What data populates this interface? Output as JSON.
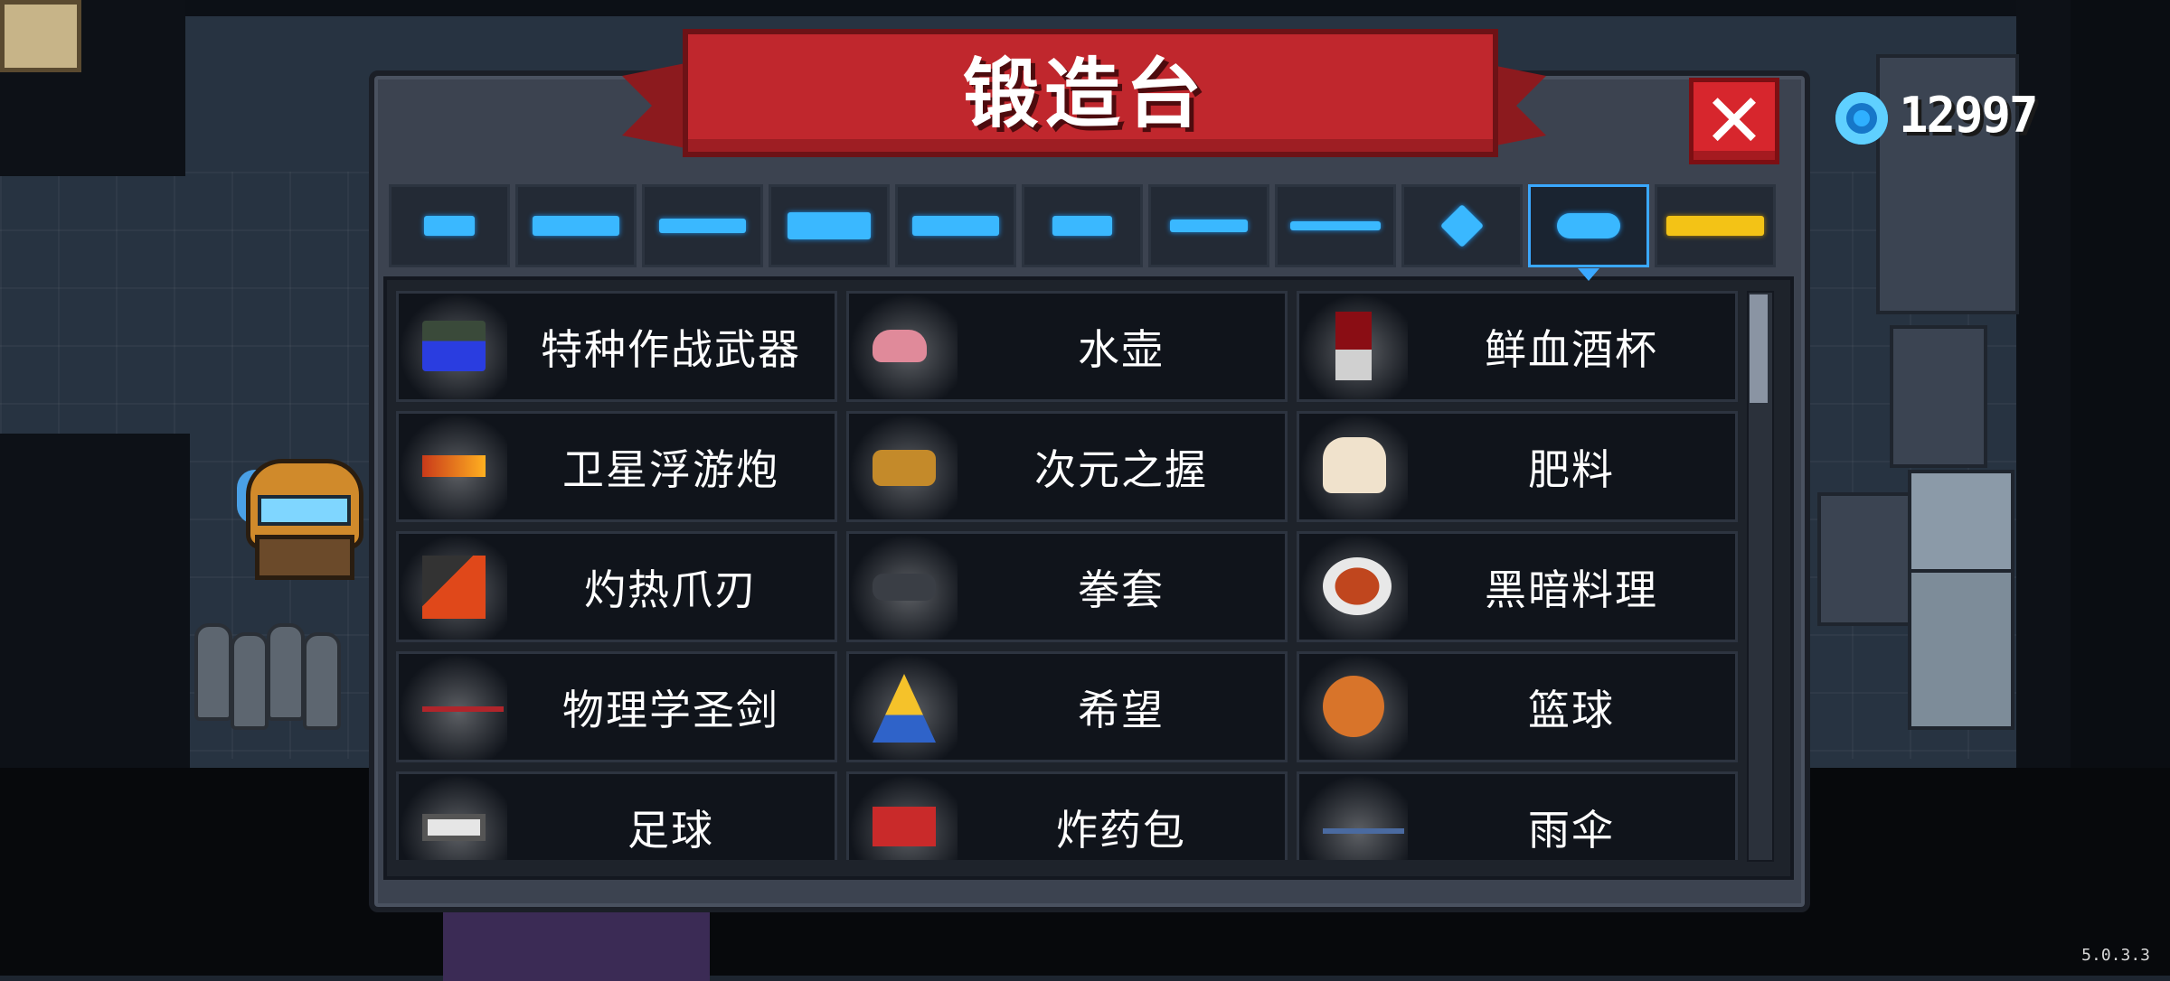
{
  "title": "锻造台",
  "close_label": "✕",
  "currency": {
    "amount": "12997",
    "icon": "blue-gem-icon"
  },
  "version": "5.0.3.3",
  "tabs": [
    {
      "icon": "pistol-icon"
    },
    {
      "icon": "assault-rifle-icon"
    },
    {
      "icon": "shotgun-icon"
    },
    {
      "icon": "rocket-launcher-icon"
    },
    {
      "icon": "laser-rifle-icon"
    },
    {
      "icon": "bow-icon"
    },
    {
      "icon": "sword-icon"
    },
    {
      "icon": "spear-icon"
    },
    {
      "icon": "shuriken-icon"
    },
    {
      "icon": "fish-icon",
      "selected": true
    },
    {
      "icon": "crown-icon"
    }
  ],
  "items": [
    {
      "name": "特种作战武器",
      "icon": "special-ops-weapon-icon"
    },
    {
      "name": "水壶",
      "icon": "watering-can-icon"
    },
    {
      "name": "鲜血酒杯",
      "icon": "blood-chalice-icon"
    },
    {
      "name": "卫星浮游炮",
      "icon": "satellite-cannon-icon"
    },
    {
      "name": "次元之握",
      "icon": "dimension-grip-icon"
    },
    {
      "name": "肥料",
      "icon": "fertilizer-bag-icon"
    },
    {
      "name": "灼热爪刃",
      "icon": "burning-claw-icon"
    },
    {
      "name": "拳套",
      "icon": "gauntlet-icon"
    },
    {
      "name": "黑暗料理",
      "icon": "dark-cuisine-icon"
    },
    {
      "name": "物理学圣剑",
      "icon": "crowbar-icon"
    },
    {
      "name": "希望",
      "icon": "praying-hands-icon"
    },
    {
      "name": "篮球",
      "icon": "basketball-icon"
    },
    {
      "name": "足球",
      "icon": "soccer-ball-icon"
    },
    {
      "name": "炸药包",
      "icon": "dynamite-pack-icon"
    },
    {
      "name": "雨伞",
      "icon": "umbrella-icon"
    }
  ]
}
